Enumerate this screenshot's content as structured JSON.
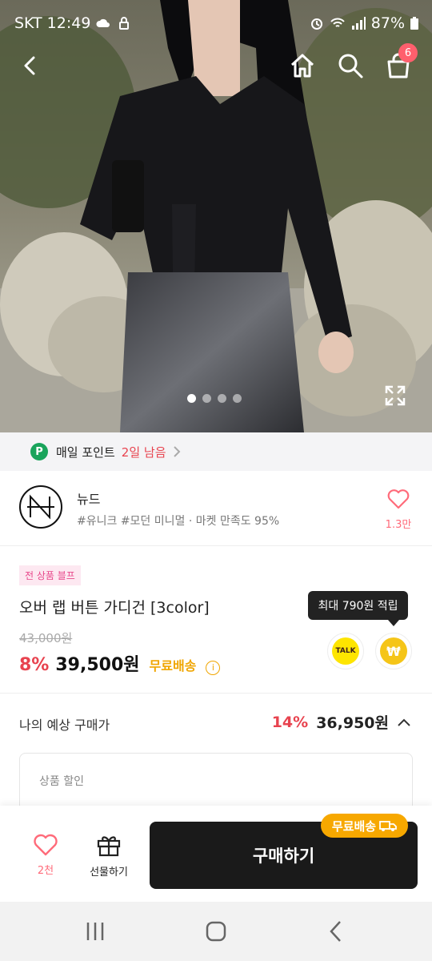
{
  "status_bar": {
    "carrier": "SKT",
    "time": "12:49",
    "battery": "87%"
  },
  "nav": {
    "cart_count": "6"
  },
  "gallery": {
    "current": 1,
    "total": 4
  },
  "points_banner": {
    "badge": "P",
    "label": "매일 포인트",
    "days_left": "2일 남음"
  },
  "brand": {
    "name": "뉴드",
    "tags": "#유니크 #모던 미니멀 · 마켓 만족도 95%",
    "like_count": "1.3만"
  },
  "product": {
    "tag": "전 상품 블프",
    "title": "오버 랩 버튼 가디건 [3color]",
    "original_price": "43,000원",
    "discount": "8%",
    "price": "39,500원",
    "free_shipping": "무료배송",
    "tooltip": "최대 790원 적립",
    "talk_label": "TALK",
    "won_label": "₩"
  },
  "expected": {
    "label": "나의 예상 구매가",
    "percent": "14%",
    "price": "36,950원",
    "detail_label": "상품 할인"
  },
  "bottom": {
    "like_count": "2천",
    "gift_label": "선물하기",
    "buy_label": "구매하기",
    "ship_pill": "무료배송"
  },
  "colors": {
    "accent_red": "#e8434f",
    "ship_orange": "#f7a800",
    "buy_dark": "#1a1a1a"
  }
}
